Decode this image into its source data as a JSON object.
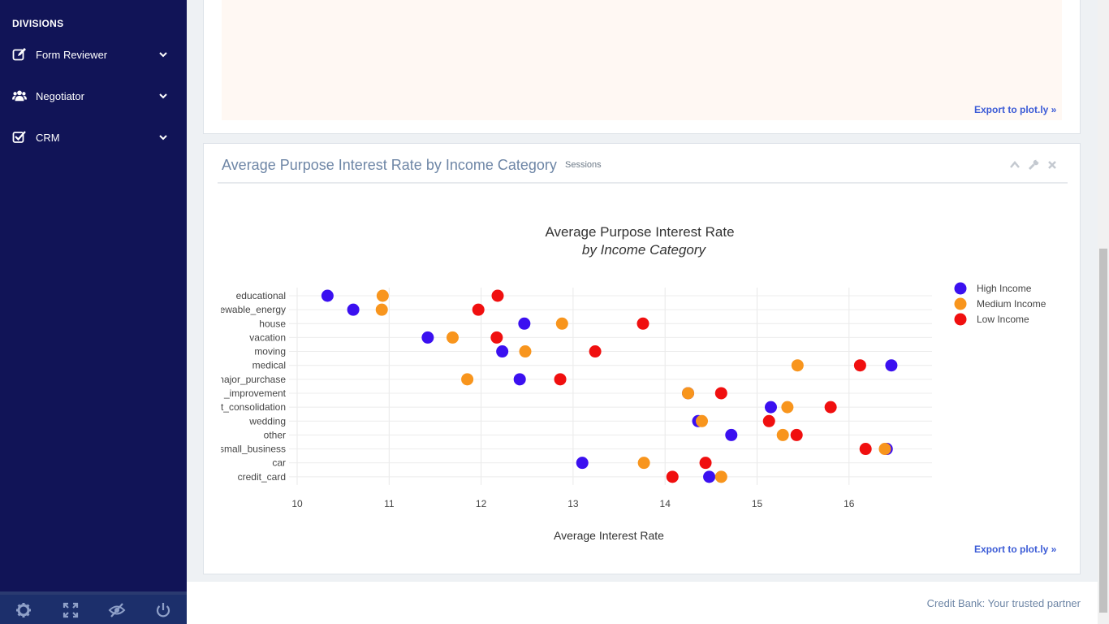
{
  "sidebar": {
    "heading": "DIVISIONS",
    "items": [
      {
        "label": "Form Reviewer",
        "icon": "edit-icon"
      },
      {
        "label": "Negotiator",
        "icon": "users-icon"
      },
      {
        "label": "CRM",
        "icon": "checkbox-icon"
      }
    ],
    "footer_icons": [
      "gear-icon",
      "fullscreen-icon",
      "eye-slash-icon",
      "power-icon"
    ]
  },
  "top_panel": {
    "export_label": "Export to plot.ly »"
  },
  "panel": {
    "title": "Average Purpose Interest Rate by Income Category",
    "subtitle": "Sessions",
    "export_label": "Export to plot.ly »",
    "tools": [
      "chevron-up-icon",
      "wrench-icon",
      "close-icon"
    ]
  },
  "footer": {
    "text": "Credit Bank: Your trusted partner"
  },
  "colors": {
    "sidebar_bg": "#111457",
    "high_income": "#3b10f0",
    "medium_income": "#f8951d",
    "low_income": "#f00f0f",
    "link": "#3b5bd6",
    "title": "#6e86a6"
  },
  "chart_data": {
    "type": "scatter",
    "title": "Average Purpose Interest Rate",
    "subtitle": "by Income Category",
    "xlabel": "Average Interest Rate",
    "ylabel": "",
    "xlim": [
      10,
      16.9
    ],
    "xticks": [
      10,
      11,
      12,
      13,
      14,
      15,
      16
    ],
    "grid": true,
    "legend_position": "top-right",
    "categories": [
      "educational",
      "renewable_energy",
      "house",
      "vacation",
      "moving",
      "medical",
      "major_purchase",
      "home_improvement",
      "debt_consolidation",
      "wedding",
      "other",
      "small_business",
      "car",
      "credit_card"
    ],
    "category_labels": [
      "educational",
      "ewable_energy",
      "house",
      "vacation",
      "moving",
      "medical",
      "najor_purchase",
      "_improvement",
      "t_consolidation",
      "wedding",
      "other",
      "small_business",
      "car",
      "credit_card"
    ],
    "series": [
      {
        "name": "High Income",
        "color": "#3b10f0",
        "values": [
          10.33,
          10.61,
          12.47,
          11.42,
          12.23,
          16.46,
          12.42,
          14.25,
          15.15,
          14.36,
          14.72,
          16.41,
          13.1,
          14.48
        ]
      },
      {
        "name": "Medium Income",
        "color": "#f8951d",
        "values": [
          10.93,
          10.92,
          12.88,
          11.69,
          12.48,
          15.44,
          11.85,
          14.25,
          15.33,
          14.4,
          15.28,
          16.39,
          13.77,
          14.61
        ]
      },
      {
        "name": "Low Income",
        "color": "#f00f0f",
        "values": [
          12.18,
          11.97,
          13.76,
          12.17,
          13.24,
          16.12,
          12.86,
          14.61,
          15.8,
          15.13,
          15.43,
          16.18,
          14.44,
          14.08
        ]
      }
    ]
  }
}
